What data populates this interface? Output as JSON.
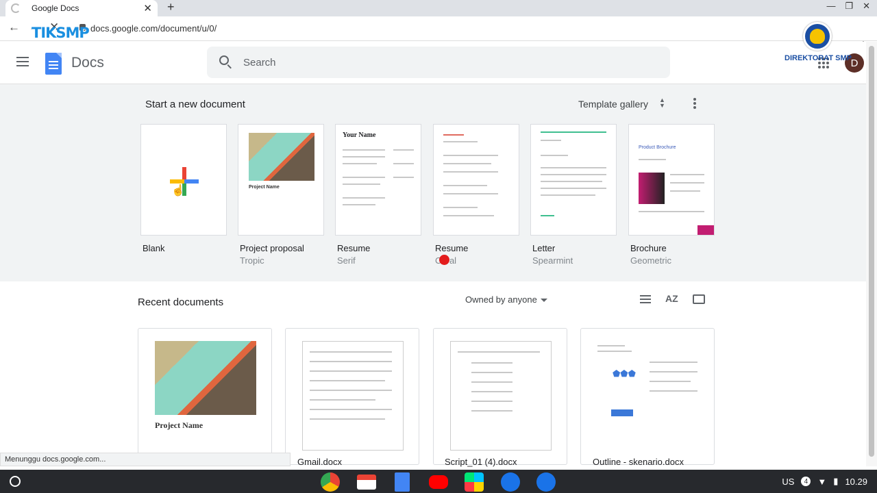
{
  "browser": {
    "tab_title": "Google Docs",
    "url": "docs.google.com/document/u/0/",
    "status_text": "Menunggu docs.google.com..."
  },
  "overlay": {
    "watermark": "TIKSMP",
    "org_label": "DIREKTORAT SMP"
  },
  "header": {
    "app_name": "Docs",
    "search_placeholder": "Search",
    "avatar_letter": "D"
  },
  "new_doc": {
    "title": "Start a new document",
    "template_gallery": "Template gallery",
    "templates": [
      {
        "name": "Blank",
        "sub": ""
      },
      {
        "name": "Project proposal",
        "sub": "Tropic",
        "thumb_title": "Project Name"
      },
      {
        "name": "Resume",
        "sub": "Serif",
        "thumb_title": "Your Name"
      },
      {
        "name": "Resume",
        "sub": "Coral"
      },
      {
        "name": "Letter",
        "sub": "Spearmint"
      },
      {
        "name": "Brochure",
        "sub": "Geometric",
        "thumb_title": "Product Brochure"
      }
    ]
  },
  "recent": {
    "title": "Recent documents",
    "owner_filter": "Owned by anyone",
    "docs": [
      {
        "name": "",
        "thumb_title": "Project Name"
      },
      {
        "name": "Gmail.docx"
      },
      {
        "name": "Script_01 (4).docx"
      },
      {
        "name": "Outline - skenario.docx"
      }
    ]
  },
  "shelf": {
    "locale": "US",
    "notif_count": "4",
    "time": "10.29"
  },
  "colors": {
    "docs_blue": "#4285f4",
    "avatar_bg": "#5d2f27",
    "shelf_bg": "#27292d"
  }
}
